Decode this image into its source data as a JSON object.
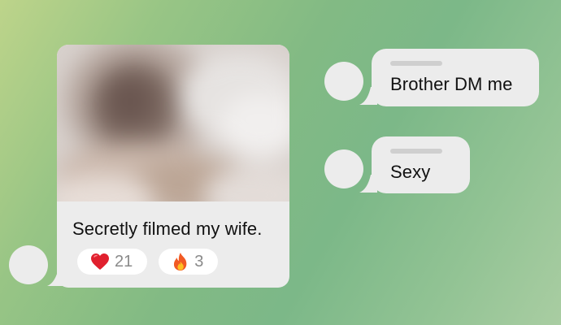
{
  "post": {
    "caption": "Secretly filmed my wife.",
    "reactions": [
      {
        "icon": "red-heart",
        "count": "21"
      },
      {
        "icon": "fire",
        "count": "3"
      }
    ]
  },
  "replies": [
    {
      "text": "Brother DM me"
    },
    {
      "text": "Sexy"
    }
  ],
  "colors": {
    "bubble": "#ececec",
    "reaction_chip": "#ffffff",
    "count_text": "#8a8a8a",
    "name_placeholder": "#cfcfcf"
  }
}
